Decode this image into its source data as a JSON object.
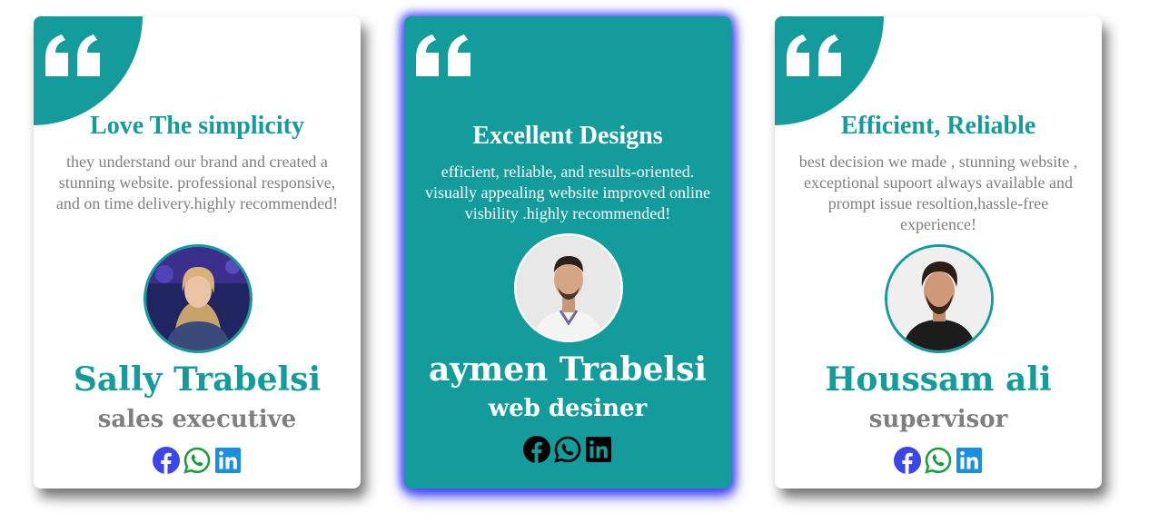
{
  "colors": {
    "accent": "#149c9c",
    "muted_text": "#7f7f7f",
    "featured_glow": "#3c3cff",
    "facebook": "#3b45e8",
    "whatsapp": "#1e9e3a",
    "linkedin": "#1a8fe0"
  },
  "testimonials": [
    {
      "title": "Love The simplicity",
      "text": "they understand our brand and created a stunning website. professional responsive, and on time delivery.highly recommended!",
      "name": "Sally Trabelsi",
      "role": "sales executive",
      "icons": [
        "quote-icon",
        "facebook-icon",
        "whatsapp-icon",
        "linkedin-icon"
      ]
    },
    {
      "title": "Excellent Designs",
      "text": "efficient, reliable, and results-oriented. visually appealing website improved online visbility .highly recommended!",
      "name": "aymen Trabelsi",
      "role": "web desiner",
      "icons": [
        "quote-icon",
        "facebook-icon",
        "whatsapp-icon",
        "linkedin-icon"
      ]
    },
    {
      "title": "Efficient, Reliable",
      "text": "best decision we made , stunning website , exceptional supoort always available and prompt issue resoltion,hassle-free experience!",
      "name": "Houssam ali",
      "role": "supervisor",
      "icons": [
        "quote-icon",
        "facebook-icon",
        "whatsapp-icon",
        "linkedin-icon"
      ]
    }
  ]
}
